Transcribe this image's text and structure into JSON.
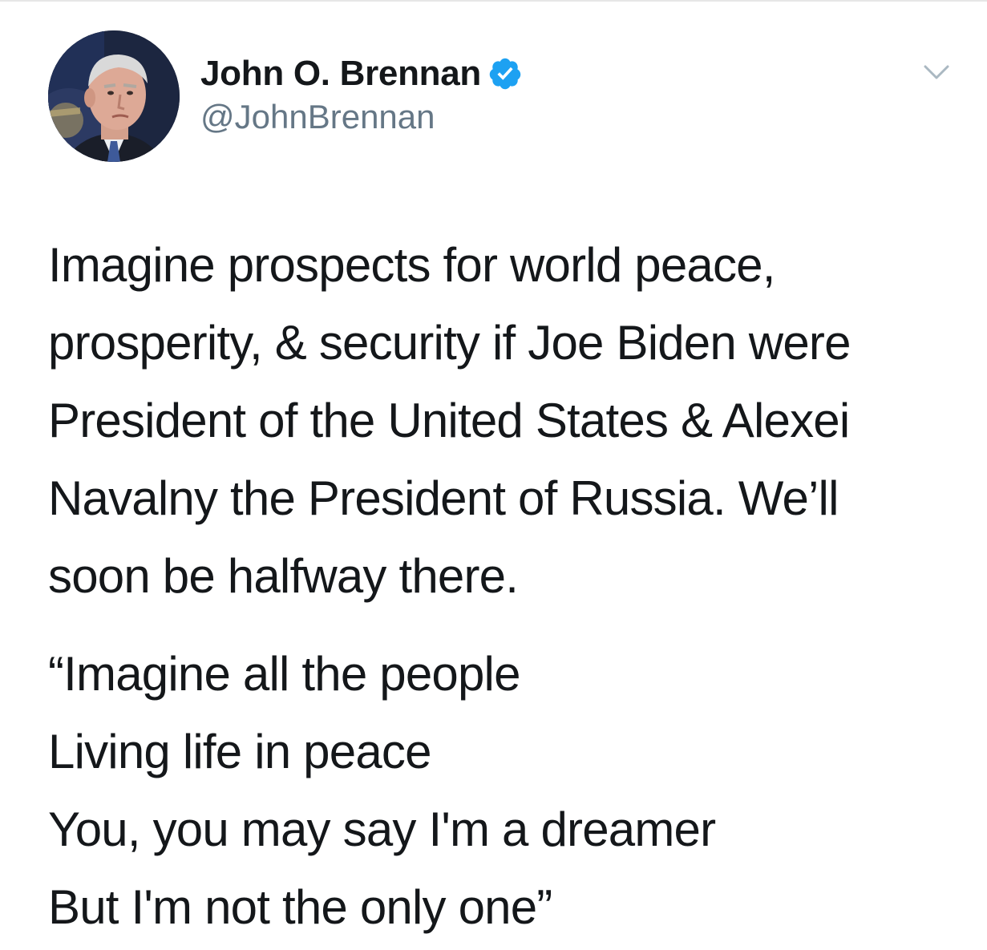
{
  "tweet": {
    "author": {
      "display_name": "John O. Brennan",
      "handle": "@JohnBrennan",
      "verified": true,
      "avatar_icon": "profile-photo"
    },
    "paragraph_1": [
      "Imagine prospects for world peace,",
      "prosperity, & security if Joe Biden were",
      "President of the United States & Alexei",
      "Navalny the President of Russia. We’ll",
      "soon be halfway there."
    ],
    "paragraph_2": [
      "“Imagine all the people",
      "Living life in peace",
      "You, you may say I'm a dreamer",
      "But I'm not the only one”"
    ]
  },
  "icons": {
    "verified": "verified-badge-icon",
    "caret": "chevron-down-icon"
  },
  "colors": {
    "text": "#14171a",
    "secondary": "#657786",
    "verified_blue": "#1da1f2",
    "caret": "#aab8c2"
  }
}
